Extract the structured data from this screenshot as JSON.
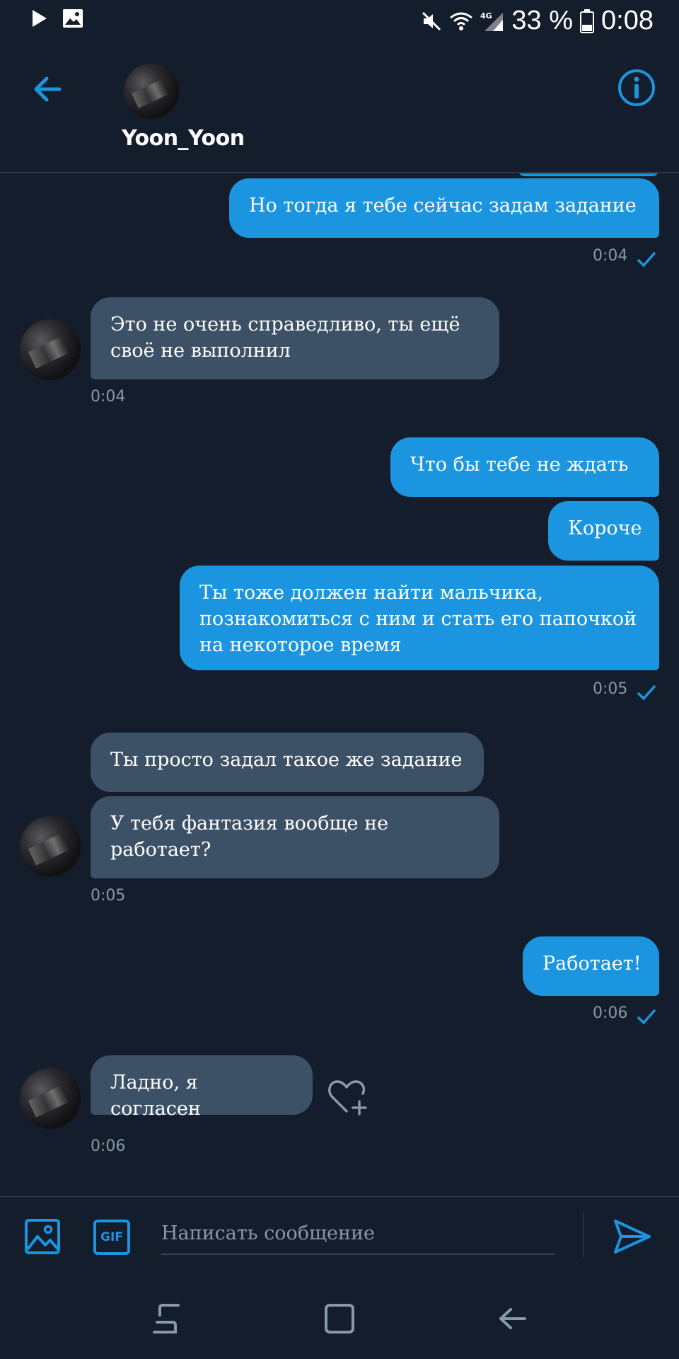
{
  "status_bar": {
    "battery": "33 %",
    "time": "0:08",
    "network": "4G",
    "icons": [
      "play-icon",
      "image-icon",
      "mute-icon",
      "wifi-icon",
      "signal-icon",
      "battery-icon"
    ]
  },
  "header": {
    "contact_name": "Yoon_Yoon",
    "icons": [
      "back-arrow-icon",
      "info-icon"
    ]
  },
  "messages": [
    {
      "direction": "out",
      "text": "Но тогда я тебе сейчас задам задание"
    },
    {
      "direction": "out",
      "time": "0:04",
      "status": "read"
    },
    {
      "direction": "in",
      "text": "Это не очень справедливо, ты ещё своё не выполнил",
      "time": "0:04"
    },
    {
      "direction": "out",
      "text": "Что бы тебе не ждать"
    },
    {
      "direction": "out",
      "text": "Короче"
    },
    {
      "direction": "out",
      "text": "Ты тоже должен найти мальчика, познакомиться с ним и стать его папочкой на некоторое время",
      "time": "0:05",
      "status": "read"
    },
    {
      "direction": "in",
      "text": "Ты просто задал такое же задание"
    },
    {
      "direction": "in",
      "text": "У тебя фантазия вообще не работает?",
      "time": "0:05"
    },
    {
      "direction": "out",
      "text": "Работает!",
      "time": "0:06",
      "status": "read"
    },
    {
      "direction": "in",
      "text": "Ладно, я согласен",
      "time": "0:06"
    }
  ],
  "composer": {
    "placeholder": "Написать сообщение",
    "gif_label": "GIF",
    "icons": [
      "image-upload-icon",
      "gif-icon",
      "send-icon"
    ]
  },
  "nav_bar": {
    "icons": [
      "recent-apps-icon",
      "home-icon",
      "back-icon"
    ]
  },
  "colors": {
    "background": "#141d2b",
    "outgoing_bubble": "#1b95e0",
    "incoming_bubble": "#3d5166",
    "accent": "#1b95e0",
    "secondary_text": "#8899a6"
  }
}
